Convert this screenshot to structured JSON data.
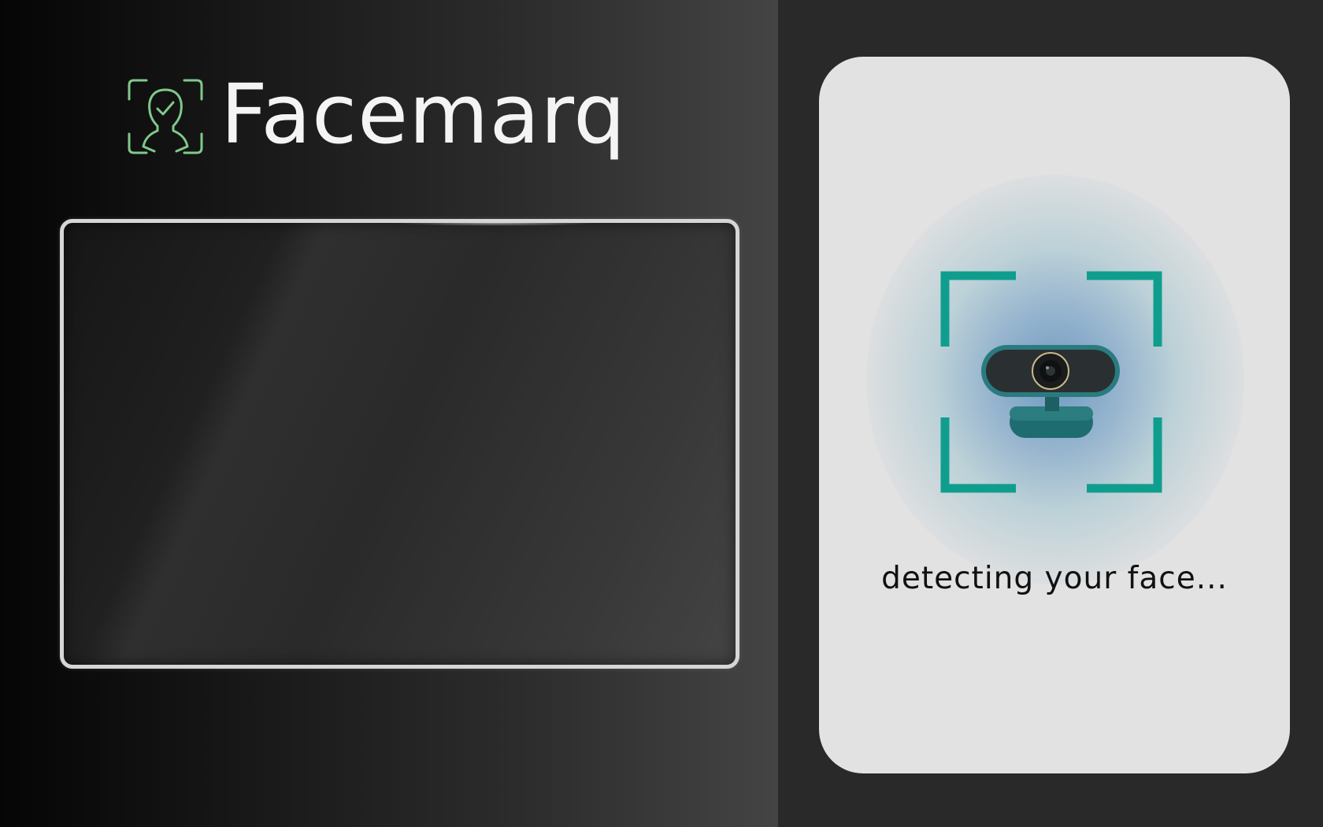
{
  "brand": {
    "name": "Facemarq",
    "logo_icon": "face-scan-check-icon",
    "accent_color": "#7fc98a"
  },
  "camera_view": {
    "icon": "camera-feed-placeholder"
  },
  "status_card": {
    "icon": "webcam-icon",
    "scan_frame_color": "#0f9e8e",
    "message": "detecting your face..."
  }
}
